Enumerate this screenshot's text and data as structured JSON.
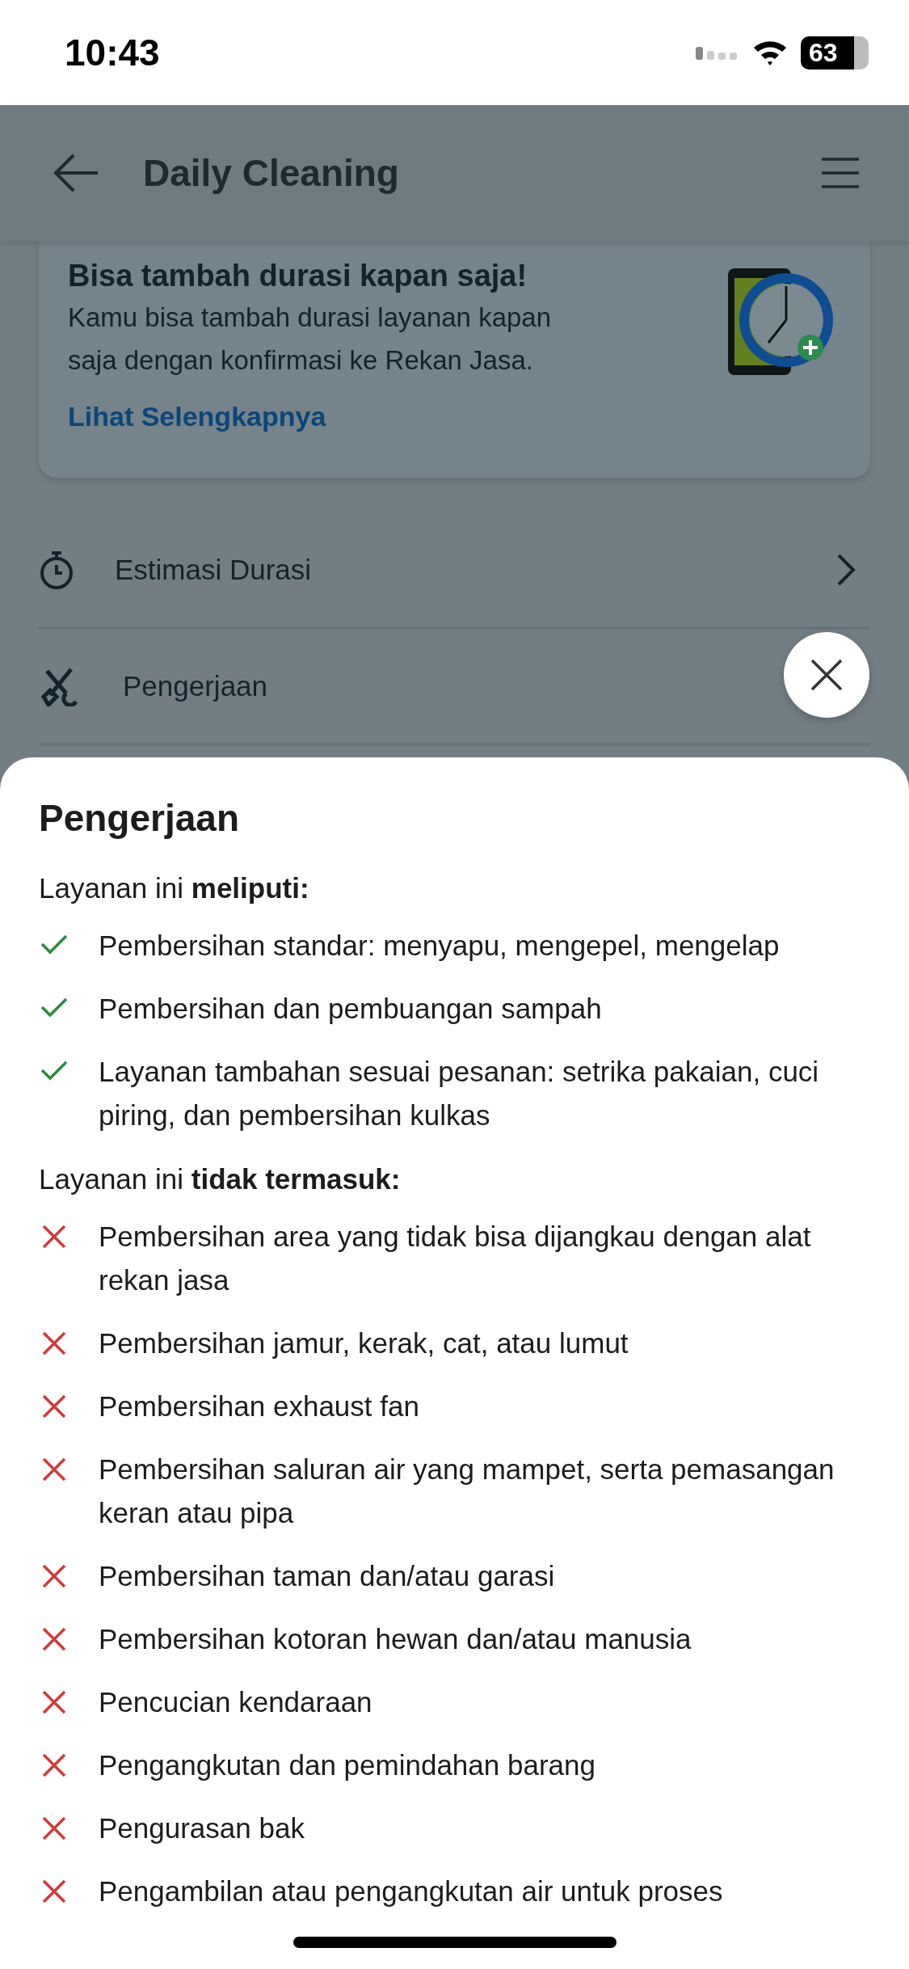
{
  "status_bar": {
    "time": "10:43",
    "battery": "63"
  },
  "header": {
    "title": "Daily Cleaning"
  },
  "promo_card": {
    "title": "Bisa tambah durasi kapan saja!",
    "body": "Kamu bisa tambah durasi layanan kapan saja dengan konfirmasi ke Rekan Jasa.",
    "link": "Lihat Selengkapnya"
  },
  "menu_items": [
    {
      "label": "Estimasi Durasi",
      "kind": "duration",
      "chevron": true
    },
    {
      "label": "Pengerjaan",
      "kind": "work"
    }
  ],
  "sheet": {
    "title": "Pengerjaan",
    "sections": [
      {
        "heading": "Layanan ini **meliputi:**",
        "included": true,
        "items": [
          "Pembersihan standar: menyapu, mengepel, mengelap",
          "Pembersihan dan pembuangan sampah",
          "Layanan tambahan sesuai pesanan: setrika pakaian, cuci piring, dan pembersihan kulkas"
        ]
      },
      {
        "heading": "Layanan ini **tidak termasuk:**",
        "included": false,
        "items": [
          "Pembersihan area yang tidak bisa dijangkau dengan alat rekan jasa",
          "Pembersihan jamur, kerak, cat, atau lumut",
          "Pembersihan exhaust fan",
          "Pembersihan saluran air yang mampet, serta pemasangan keran atau pipa",
          "Pembersihan taman dan/atau garasi",
          "Pembersihan kotoran hewan dan/atau manusia",
          "Pencucian kendaraan",
          "Pengangkutan dan pemindahan barang",
          "Pengurasan bak",
          "Pengambilan atau pengangkutan air untuk proses"
        ]
      }
    ]
  }
}
